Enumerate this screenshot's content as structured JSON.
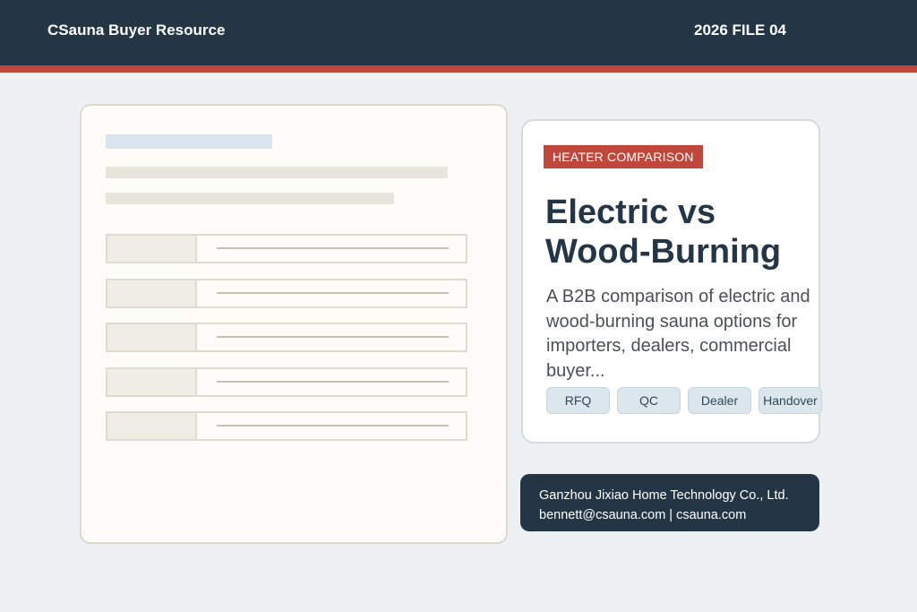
{
  "header": {
    "brand": "CSauna Buyer Resource",
    "file_label": "2026 FILE 04"
  },
  "feature": {
    "badge": "HEATER COMPARISON",
    "headline_line1": "Electric vs",
    "headline_line2": "Wood-Burning",
    "summary": "A B2B comparison of electric and wood-burning sauna options for importers, dealers, commercial buyer...",
    "tags": [
      "RFQ",
      "QC",
      "Dealer",
      "Handover"
    ]
  },
  "contact": {
    "company": "Ganzhou Jixiao Home Technology Co., Ltd.",
    "email_site": "bennett@csauna.com | csauna.com"
  },
  "colors": {
    "header_bg": "#243646",
    "accent": "#c0473b",
    "page_bg": "#edf1f4",
    "tag_bg": "#dbe7ed"
  }
}
